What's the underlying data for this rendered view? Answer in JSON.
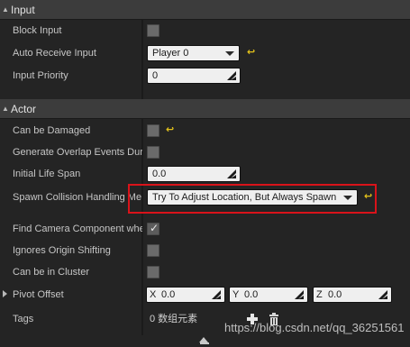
{
  "sections": {
    "input": {
      "title": "Input"
    },
    "actor": {
      "title": "Actor"
    }
  },
  "input": {
    "block_input": {
      "label": "Block Input",
      "checked": false
    },
    "auto_receive_input": {
      "label": "Auto Receive Input",
      "value": "Player 0"
    },
    "input_priority": {
      "label": "Input Priority",
      "value": "0"
    }
  },
  "actor": {
    "can_be_damaged": {
      "label": "Can be Damaged",
      "checked": false
    },
    "generate_overlap": {
      "label": "Generate Overlap Events Dur",
      "checked": false
    },
    "initial_life_span": {
      "label": "Initial Life Span",
      "value": "0.0"
    },
    "spawn_collision": {
      "label": "Spawn Collision Handling Me",
      "value": "Try To Adjust Location, But Always Spawn"
    },
    "find_camera": {
      "label": "Find Camera Component whe",
      "checked": true
    },
    "ignores_origin": {
      "label": "Ignores Origin Shifting",
      "checked": false
    },
    "can_be_in_cluster": {
      "label": "Can be in Cluster",
      "checked": false
    },
    "pivot_offset": {
      "label": "Pivot Offset",
      "x_label": "X",
      "x": "0.0",
      "y_label": "Y",
      "y": "0.0",
      "z_label": "Z",
      "z": "0.0"
    },
    "tags": {
      "label": "Tags",
      "count_text": "0 数组元素"
    }
  },
  "watermark": "https://blog.csdn.net/qq_36251561",
  "icons": {
    "collapse": "triangle-down-icon",
    "reset": "reset-arrow-icon",
    "add": "plus-icon",
    "delete": "trash-icon",
    "expand": "triangle-right-icon"
  },
  "colors": {
    "background": "#242424",
    "section_header": "#3c3c3c",
    "reset_arrow": "#e3c21b",
    "highlight": "#d9131a"
  }
}
